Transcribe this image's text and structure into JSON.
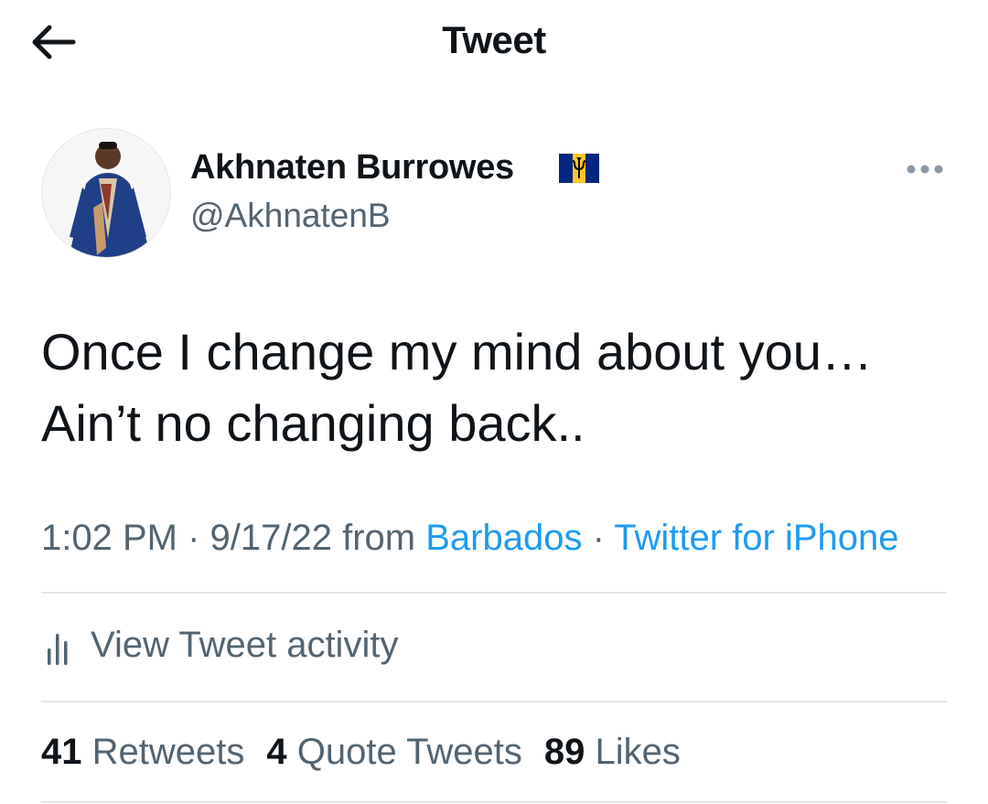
{
  "header": {
    "title": "Tweet"
  },
  "author": {
    "name": "Akhnaten Burrowes",
    "handle": "@AkhnatenB",
    "flag": "barbados-flag"
  },
  "tweet": {
    "lines": [
      "Once I change my mind about you…",
      "Ain’t no changing back.."
    ]
  },
  "meta": {
    "time": "1:02 PM",
    "sep1": " · ",
    "date": "9/17/22",
    "from": " from ",
    "location": "Barbados",
    "sep2": " · ",
    "source": "Twitter for iPhone"
  },
  "activity": {
    "label": "View Tweet activity"
  },
  "stats": [
    {
      "count": "41",
      "label": "Retweets"
    },
    {
      "count": "4",
      "label": "Quote Tweets"
    },
    {
      "count": "89",
      "label": "Likes"
    }
  ],
  "colors": {
    "link": "#1d9bf0",
    "muted": "#536471",
    "text": "#0f1419"
  }
}
